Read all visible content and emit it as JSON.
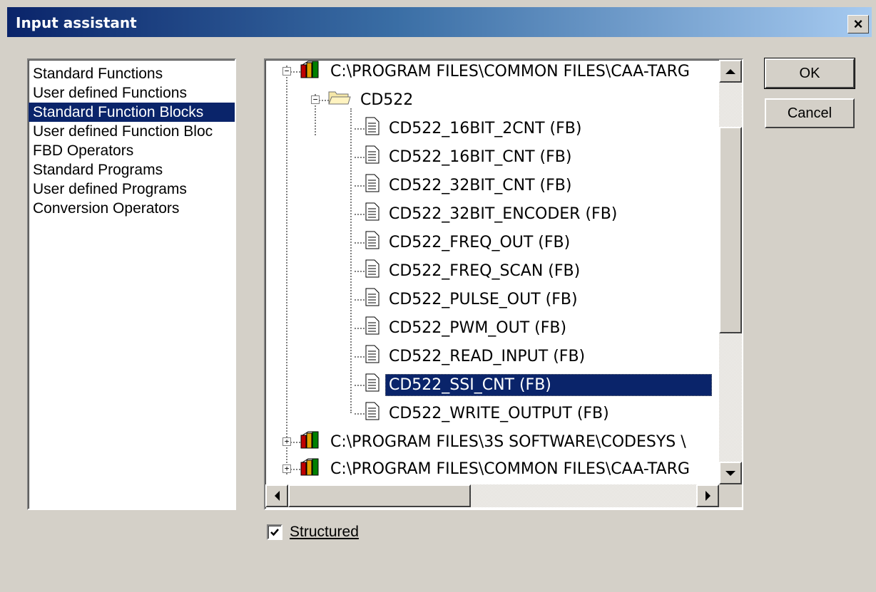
{
  "window": {
    "title": "Input assistant"
  },
  "categories": {
    "items": [
      {
        "label": "Standard Functions"
      },
      {
        "label": "User defined Functions"
      },
      {
        "label": "Standard Function Blocks",
        "selected": true
      },
      {
        "label": "User defined Function Bloc"
      },
      {
        "label": "FBD Operators"
      },
      {
        "label": "Standard Programs"
      },
      {
        "label": "User defined Programs"
      },
      {
        "label": "Conversion Operators"
      }
    ]
  },
  "tree": {
    "root1": "C:\\PROGRAM FILES\\COMMON FILES\\CAA-TARG",
    "folder": "CD522",
    "items": [
      "CD522_16BIT_2CNT (FB)",
      "CD522_16BIT_CNT (FB)",
      "CD522_32BIT_CNT (FB)",
      "CD522_32BIT_ENCODER (FB)",
      "CD522_FREQ_OUT (FB)",
      "CD522_FREQ_SCAN (FB)",
      "CD522_PULSE_OUT (FB)",
      "CD522_PWM_OUT (FB)",
      "CD522_READ_INPUT (FB)",
      "CD522_SSI_CNT (FB)",
      "CD522_WRITE_OUTPUT (FB)"
    ],
    "selected_item": "CD522_SSI_CNT (FB)",
    "root2": "C:\\PROGRAM FILES\\3S SOFTWARE\\CODESYS \\",
    "root3": "C:\\PROGRAM FILES\\COMMON FILES\\CAA-TARG"
  },
  "buttons": {
    "ok": "OK",
    "cancel": "Cancel"
  },
  "structured": {
    "label": "Structured",
    "checked": true
  },
  "colors": {
    "selection": "#0a246a",
    "face": "#d4d0c8",
    "title_start": "#0a246a",
    "title_end": "#a6caf0"
  }
}
